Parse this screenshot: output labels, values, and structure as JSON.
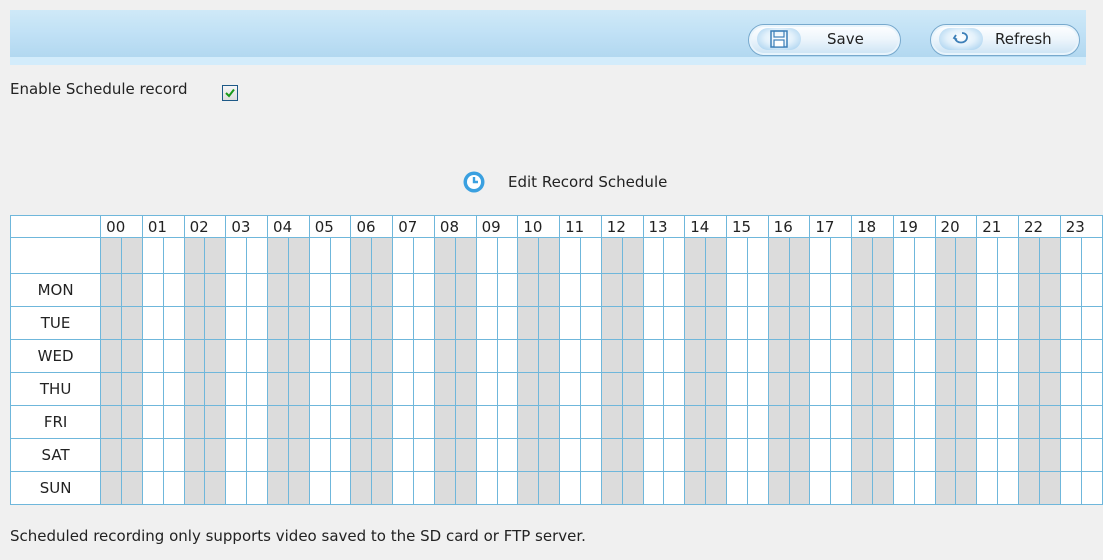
{
  "toolbar": {
    "save_label": "Save",
    "refresh_label": "Refresh"
  },
  "enable": {
    "label": "Enable Schedule record",
    "checked": true
  },
  "edit_schedule": {
    "label": "Edit Record Schedule"
  },
  "schedule": {
    "hours": [
      "00",
      "01",
      "02",
      "03",
      "04",
      "05",
      "06",
      "07",
      "08",
      "09",
      "10",
      "11",
      "12",
      "13",
      "14",
      "15",
      "16",
      "17",
      "18",
      "19",
      "20",
      "21",
      "22",
      "23"
    ],
    "days": [
      "MON",
      "TUE",
      "WED",
      "THU",
      "FRI",
      "SAT",
      "SUN"
    ]
  },
  "footnote": "Scheduled recording only supports video saved to the SD card or FTP server.",
  "colors": {
    "toolbar": "#bfe0f5",
    "grid_line": "#6fb7db",
    "shaded_cell": "#dcdcdc",
    "accent": "#3aa0e0"
  }
}
